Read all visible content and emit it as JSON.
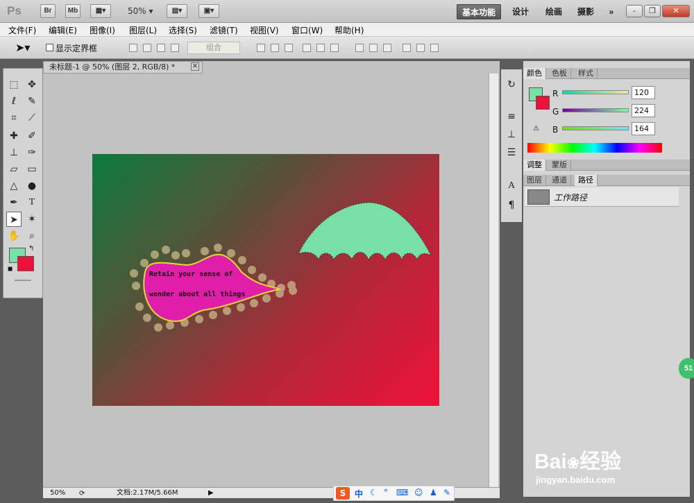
{
  "app": {
    "logo": "Ps",
    "btn_br": "Br",
    "btn_mb": "Mb",
    "zoom": "50%"
  },
  "workspaces": [
    "基本功能",
    "设计",
    "绘画",
    "摄影",
    "»"
  ],
  "window_controls": {
    "min": "–",
    "max": "❐",
    "close": "✕"
  },
  "menu": [
    "文件(F)",
    "编辑(E)",
    "图像(I)",
    "图层(L)",
    "选择(S)",
    "滤镜(T)",
    "视图(V)",
    "窗口(W)",
    "帮助(H)"
  ],
  "options": {
    "show_bounds": "显示定界框",
    "combine": "组合"
  },
  "document": {
    "tab": "未标题-1 @ 50% (图层 2, RGB/8) *",
    "text_line1": "Retain your sense of",
    "text_line2": "wonder about all things"
  },
  "status": {
    "zoom": "50%",
    "doc": "文档:2.17M/5.66M"
  },
  "color_panel": {
    "tabs": [
      "颜色",
      "色板",
      "样式"
    ],
    "r_label": "R",
    "g_label": "G",
    "b_label": "B",
    "r": "120",
    "g": "224",
    "b": "164",
    "fg": "#78e0a4",
    "bg": "#f0113a"
  },
  "adjust_panel": {
    "tabs": [
      "调整",
      "蒙版"
    ]
  },
  "layers_panel": {
    "tabs": [
      "图层",
      "通道",
      "路径"
    ],
    "path_item": "工作路径"
  },
  "taskbar": {
    "ime": "中"
  },
  "watermark": {
    "brand": "Bai",
    "brand_cn": "经验",
    "url": "jingyan.baidu.com"
  },
  "side_badge": "51"
}
